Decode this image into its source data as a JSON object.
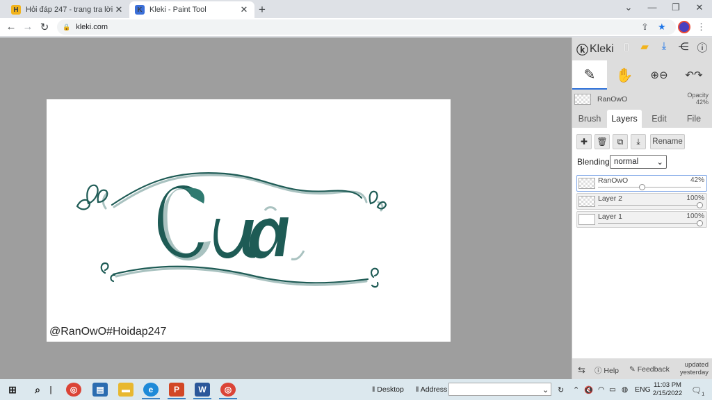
{
  "browser": {
    "tabs": [
      {
        "title": "Hỏi đáp 247 - trang tra lời",
        "favicon": "H",
        "favicon_color": "#f2b31b",
        "active": false
      },
      {
        "title": "Kleki - Paint Tool",
        "favicon": "K",
        "favicon_color": "#3b6fd8",
        "active": true
      }
    ],
    "url": "kleki.com",
    "new_tab_icon": "plus-icon"
  },
  "canvas": {
    "lettering": "Cửa",
    "watermark": "@RanOwO#Hoidap247",
    "ink_color": "#1e5b55",
    "shadow_color": "#a9c2c0"
  },
  "panel": {
    "app_name": "Kleki",
    "current_layer": {
      "name": "RanOwO",
      "opacity_label": "Opacity",
      "opacity_value": "42%"
    },
    "tabs": [
      "Brush",
      "Layers",
      "Edit",
      "File"
    ],
    "selected_tab": "Layers",
    "rename_label": "Rename",
    "blending_label": "Blending",
    "blending_value": "normal",
    "layers": [
      {
        "name": "RanOwO",
        "opacity": "42%",
        "level": 0.42,
        "selected": true
      },
      {
        "name": "Layer 2",
        "opacity": "100%",
        "level": 1.0,
        "selected": false
      },
      {
        "name": "Layer 1",
        "opacity": "100%",
        "level": 1.0,
        "selected": false
      }
    ],
    "footer": {
      "help": "Help",
      "feedback": "Feedback",
      "updated_line1": "updated",
      "updated_line2": "yesterday"
    }
  },
  "taskbar": {
    "desktop_label": "Desktop",
    "address_label": "Address",
    "language": "ENG",
    "time": "11:03 PM",
    "date": "2/15/2022",
    "notification_count": "1"
  }
}
